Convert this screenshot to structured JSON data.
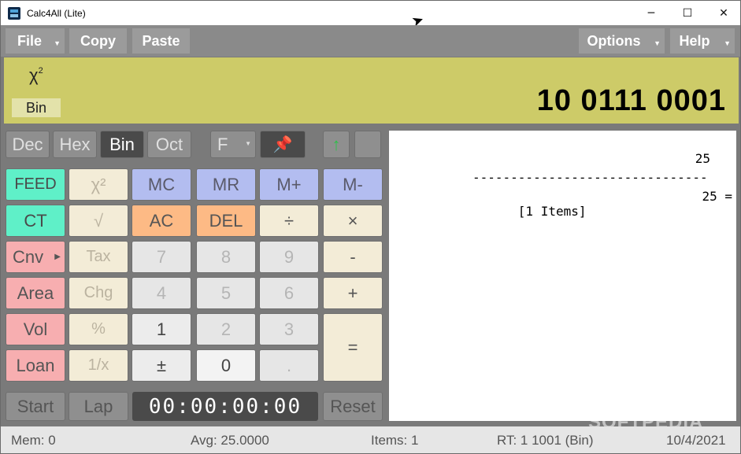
{
  "window": {
    "title": "Calc4All (Lite)",
    "minimize_glyph": "─",
    "maximize_glyph": "☐",
    "close_glyph": "✕",
    "cursor_glyph": "➤"
  },
  "menu": {
    "file": "File",
    "copy": "Copy",
    "paste": "Paste",
    "options": "Options",
    "help": "Help",
    "caret": "▼"
  },
  "display": {
    "operation": "χ",
    "operation_sup": "2",
    "base": "Bin",
    "value": "10 0111 0001"
  },
  "modes": {
    "dec": "Dec",
    "hex": "Hex",
    "bin": "Bin",
    "oct": "Oct",
    "format": "F",
    "pin_icon": "📌",
    "up_icon": "↑"
  },
  "keys": {
    "feed": "FEED",
    "x2": "χ²",
    "mc": "MC",
    "mr": "MR",
    "mplus": "M+",
    "mminus": "M-",
    "ct": "CT",
    "sqrt": "√",
    "ac": "AC",
    "del": "DEL",
    "div": "÷",
    "mul": "×",
    "cnv": "Cnv",
    "tax": "Tax",
    "n7": "7",
    "n8": "8",
    "n9": "9",
    "minus": "-",
    "area": "Area",
    "chg": "Chg",
    "n4": "4",
    "n5": "5",
    "n6": "6",
    "plus": "+",
    "vol": "Vol",
    "pct": "%",
    "n1": "1",
    "n2": "2",
    "n3": "3",
    "equals": "=",
    "loan": "Loan",
    "inv": "1/x",
    "pm": "±",
    "n0": "0",
    "dot": "."
  },
  "timer": {
    "start": "Start",
    "lap": "Lap",
    "time": "00:00:00:00",
    "reset": "Reset"
  },
  "tape": {
    "line1_value": "25",
    "separator": "-------------------------------",
    "items_label": "[1 Items]",
    "items_value": "25 ="
  },
  "watermark": "SOFTPEDIA",
  "status": {
    "mem": "Mem: 0",
    "avg": "Avg: 25.0000",
    "items": "Items: 1",
    "rt": "RT: 1 1001 (Bin)",
    "date": "10/4/2021"
  }
}
